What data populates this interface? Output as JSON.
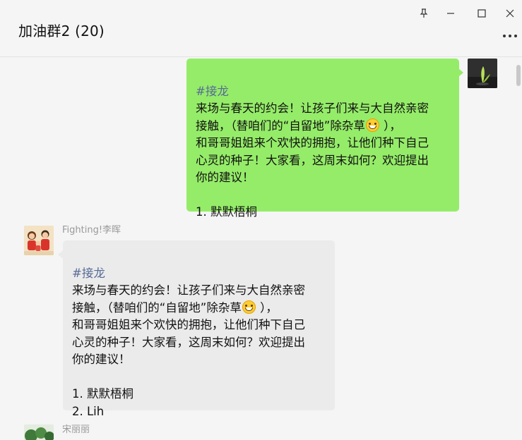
{
  "window": {
    "title": "加油群2 (20)"
  },
  "icons": [
    "pin-icon",
    "minimize-icon",
    "maximize-icon",
    "close-icon",
    "more-icon",
    "grin-emoji-icon"
  ],
  "colors": {
    "background": "#f5f5f5",
    "my_bubble": "#95ec69",
    "other_bubble": "#ebebeb",
    "tag_text": "#576b95",
    "sender_text": "#999999"
  },
  "messages": [
    {
      "self": true,
      "tag": "#接龙",
      "line1": "来场与春天的约会！让孩子们来与大自然亲密",
      "line2a": "接触，（替咱们的“自留地”除杂草",
      "line2b": " ），",
      "line3": "和哥哥姐姐来个欢快的拥抱，让他们种下自己",
      "line4": "心灵的种子！大家看，这周末如何？欢迎提出",
      "line5": "你的建议！",
      "items": [
        "1. 默默梧桐"
      ]
    },
    {
      "self": false,
      "sender": "Fighting!李晖",
      "tag": "#接龙",
      "line1": "来场与春天的约会！让孩子们来与大自然亲密",
      "line2a": "接触，（替咱们的“自留地”除杂草",
      "line2b": " ），",
      "line3": "和哥哥姐姐来个欢快的拥抱，让他们种下自己",
      "line4": "心灵的种子！大家看，这周末如何？欢迎提出",
      "line5": "你的建议！",
      "items": [
        "1. 默默梧桐",
        "2. Lih"
      ]
    },
    {
      "self": false,
      "sender": "宋丽丽"
    }
  ]
}
